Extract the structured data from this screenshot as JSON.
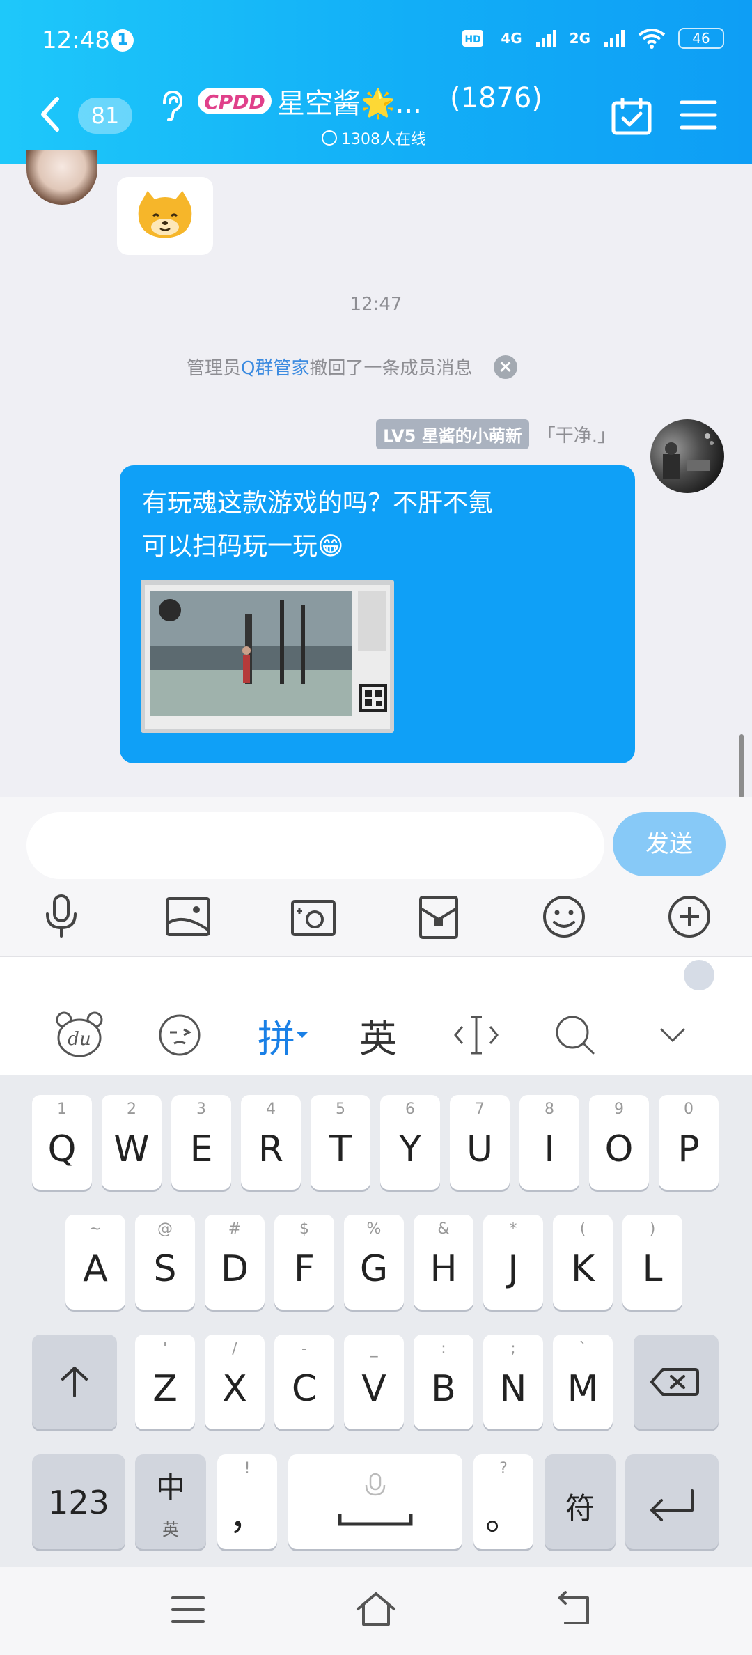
{
  "status_bar": {
    "time": "12:48",
    "notification_count": "1",
    "network": [
      "4G",
      "2G"
    ],
    "battery": "46"
  },
  "header": {
    "unread_count": "81",
    "group_title": "星空酱🌟...",
    "member_count": "(1876)",
    "online_text": "1308人在线"
  },
  "chat": {
    "timestamp": "12:47",
    "recall_notice": {
      "prefix": "管理员",
      "actor": "Q群管家",
      "suffix": "撤回了一条成员消息"
    },
    "message": {
      "level_badge": "LV5 星酱的小萌新",
      "sender_name": "「干净.」",
      "text": "有玩魂这款游戏的吗？不肝不氪\n可以扫码玩一玩😁"
    }
  },
  "input": {
    "placeholder": "",
    "send_label": "发送"
  },
  "toolbar_icons": [
    "microphone-icon",
    "photo-icon",
    "camera-icon",
    "red-envelope-icon",
    "emoji-icon",
    "plus-icon"
  ],
  "ime": {
    "pinyin_label": "拼",
    "english_label": "英"
  },
  "keyboard": {
    "row1": [
      {
        "hint": "1",
        "key": "Q"
      },
      {
        "hint": "2",
        "key": "W"
      },
      {
        "hint": "3",
        "key": "E"
      },
      {
        "hint": "4",
        "key": "R"
      },
      {
        "hint": "5",
        "key": "T"
      },
      {
        "hint": "6",
        "key": "Y"
      },
      {
        "hint": "7",
        "key": "U"
      },
      {
        "hint": "8",
        "key": "I"
      },
      {
        "hint": "9",
        "key": "O"
      },
      {
        "hint": "0",
        "key": "P"
      }
    ],
    "row2": [
      {
        "hint": "~",
        "key": "A"
      },
      {
        "hint": "@",
        "key": "S"
      },
      {
        "hint": "#",
        "key": "D"
      },
      {
        "hint": "$",
        "key": "F"
      },
      {
        "hint": "%",
        "key": "G"
      },
      {
        "hint": "&",
        "key": "H"
      },
      {
        "hint": "*",
        "key": "J"
      },
      {
        "hint": "(",
        "key": "K"
      },
      {
        "hint": ")",
        "key": "L"
      }
    ],
    "row3": [
      {
        "hint": "'",
        "key": "Z"
      },
      {
        "hint": "/",
        "key": "X"
      },
      {
        "hint": "-",
        "key": "C"
      },
      {
        "hint": "_",
        "key": "V"
      },
      {
        "hint": ":",
        "key": "B"
      },
      {
        "hint": ";",
        "key": "N"
      },
      {
        "hint": "`",
        "key": "M"
      }
    ],
    "numbers_label": "123",
    "zh_label": "中",
    "zh_sub": "英",
    "comma_hint": "!",
    "comma_label": "，",
    "period_hint": "?",
    "period_label": "。",
    "symbol_label": "符"
  },
  "colors": {
    "header_start": "#1ec8fa",
    "header_end": "#0e9ef5",
    "bubble": "#0fa0f7",
    "send_button": "#87c9f7",
    "pinyin_active": "#1a80e6"
  }
}
